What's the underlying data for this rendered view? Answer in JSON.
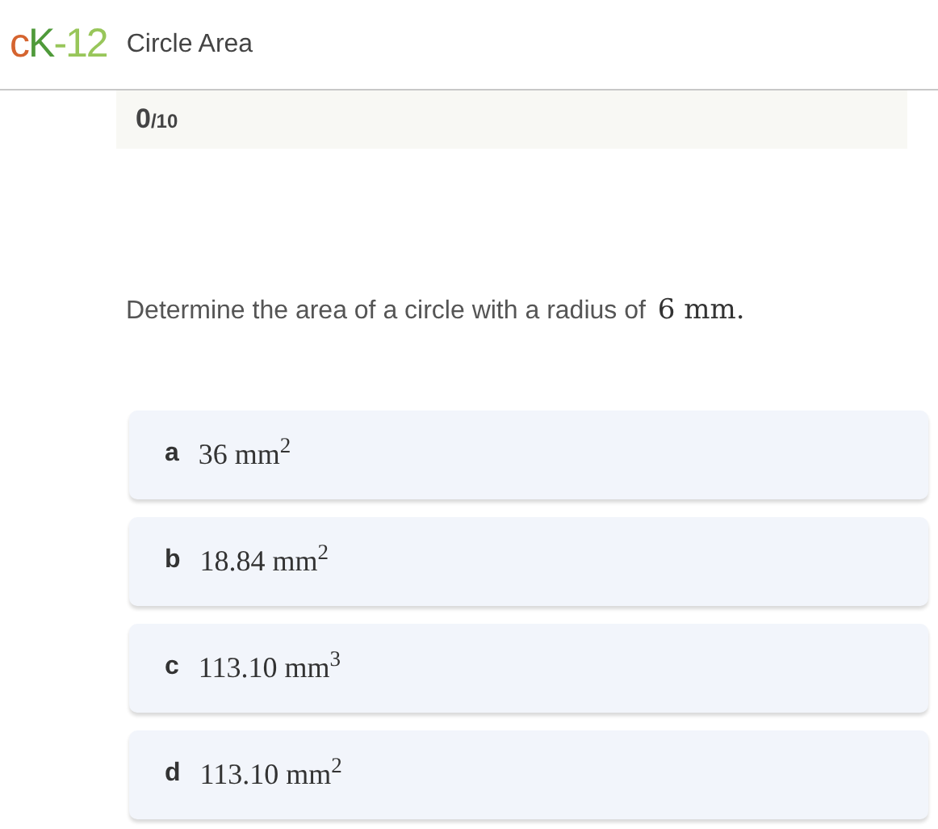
{
  "header": {
    "logo": [
      {
        "text": "c",
        "color": "#d5642f"
      },
      {
        "text": "K",
        "color": "#4f9a3a"
      },
      {
        "text": "-12",
        "color": "#98c65a"
      }
    ],
    "title": "Circle Area"
  },
  "score": {
    "value": "0",
    "total": "/10"
  },
  "question": {
    "text": "Determine the area of a circle with a radius of",
    "math": "6 mm."
  },
  "options": [
    {
      "letter": "a",
      "answer": "36 mm$^{2}$"
    },
    {
      "letter": "b",
      "answer": "18.84 mm$^{2}$"
    },
    {
      "letter": "c",
      "answer": "113.10 mm$^{3}$"
    },
    {
      "letter": "d",
      "answer": "113.10 mm$^{2}$"
    }
  ]
}
